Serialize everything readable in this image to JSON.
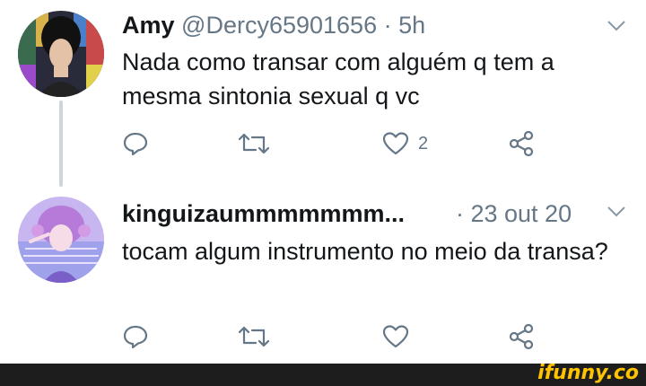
{
  "tweets": [
    {
      "author": {
        "name": "Amy",
        "handle": "@Dercy65901656",
        "time": "· 5h"
      },
      "text": "Nada como transar com alguém q tem a mesma sintonia sexual q vc",
      "actions": {
        "like_count": "2"
      }
    },
    {
      "author": {
        "name": "kinguizaummmmmmm...",
        "time": "· 23 out 20"
      },
      "text": "tocam algum instrumento no meio da transa?"
    }
  ],
  "watermark": {
    "text": "ifunny.co",
    "color": "#ffc300",
    "bar_color": "#1d1d1d"
  },
  "colors": {
    "text": "#14171a",
    "secondary": "#657786",
    "thread_line": "#cdd6dd"
  },
  "icons": [
    "reply-icon",
    "retweet-icon",
    "like-icon",
    "share-icon",
    "chevron-down-icon"
  ]
}
